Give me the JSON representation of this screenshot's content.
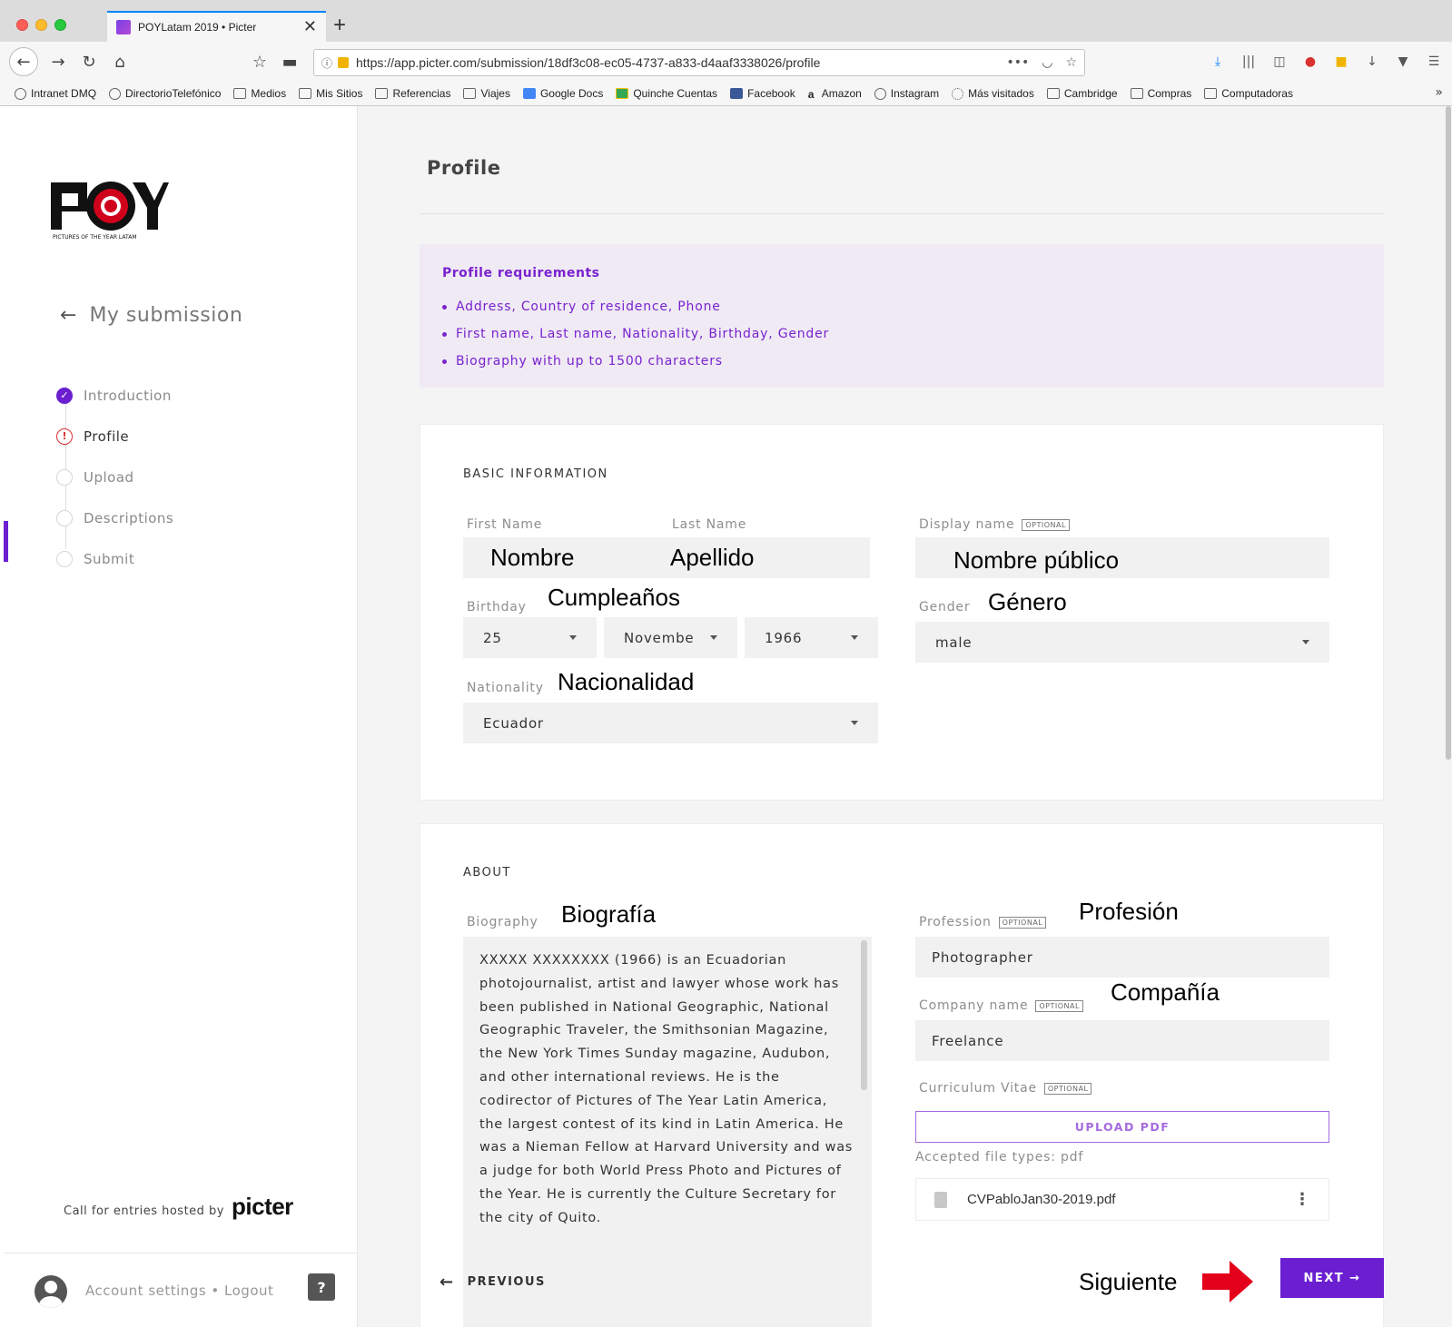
{
  "browser": {
    "tab_title": "POYLatam 2019 • Picter",
    "url": "https://app.picter.com/submission/18df3c08-ec05-4737-a833-d4aaf3338026/profile",
    "bookmarks": [
      "Intranet DMQ",
      "DirectorioTelefónico",
      "Medios",
      "Mis Sitios",
      "Referencias",
      "Viajes",
      "Google Docs",
      "Quinche Cuentas",
      "Facebook",
      "Amazon",
      "Instagram",
      "Más visitados",
      "Cambridge",
      "Compras",
      "Computadoras"
    ]
  },
  "sidebar": {
    "logo_text": "POY",
    "logo_subtitle": "PICTURES OF THE YEAR LATAM",
    "back_label": "My submission",
    "steps": [
      {
        "label": "Introduction",
        "state": "done"
      },
      {
        "label": "Profile",
        "state": "error"
      },
      {
        "label": "Upload",
        "state": "pending"
      },
      {
        "label": "Descriptions",
        "state": "pending"
      },
      {
        "label": "Submit",
        "state": "pending"
      }
    ],
    "hosted_text": "Call for entries hosted by",
    "hosted_brand": "picter",
    "account_links": "Account settings • Logout",
    "help_label": "?"
  },
  "main": {
    "page_title": "Profile",
    "requirements": {
      "title": "Profile requirements",
      "items": [
        "Address, Country of residence, Phone",
        "First name, Last name, Nationality, Birthday, Gender",
        "Biography with up to 1500 characters"
      ]
    },
    "basic": {
      "title": "BASIC INFORMATION",
      "first_name_label": "First Name",
      "first_name_value": "Nombre",
      "last_name_label": "Last Name",
      "last_name_value": "Apellido",
      "display_name_label": "Display name",
      "display_name_value": "Nombre público",
      "optional": "OPTIONAL",
      "birthday_label": "Birthday",
      "birthday_annot": "Cumpleaños",
      "birthday_day": "25",
      "birthday_month": "Novembe",
      "birthday_year": "1966",
      "gender_label": "Gender",
      "gender_annot": "Género",
      "gender_value": "male",
      "nationality_label": "Nationality",
      "nationality_annot": "Nacionalidad",
      "nationality_value": "Ecuador"
    },
    "about": {
      "title": "ABOUT",
      "bio_label": "Biography",
      "bio_annot": "Biografía",
      "bio_text": "XXXXX XXXXXXXX (1966) is an Ecuadorian photojournalist, artist and lawyer whose work has been published in National Geographic, National Geographic Traveler, the Smithsonian Magazine, the New York Times Sunday magazine, Audubon, and other international reviews. He is the codirector of Pictures of The Year Latin America, the largest contest of its kind in Latin America. He was a Nieman Fellow at Harvard University and was a judge for both World Press Photo and Pictures of the Year. He is currently the Culture Secretary for the city of Quito.",
      "profession_label": "Profession",
      "profession_annot": "Profesión",
      "profession_value": "Photographer",
      "company_label": "Company name",
      "company_annot": "Compañía",
      "company_value": "Freelance",
      "cv_label": "Curriculum Vitae",
      "upload_label": "UPLOAD PDF",
      "accepted_types": "Accepted file types: pdf",
      "file_name": "CVPabloJan30-2019.pdf"
    },
    "footer": {
      "previous_label": "PREVIOUS",
      "siguiente_annot": "Siguiente",
      "next_label": "NEXT"
    }
  },
  "colors": {
    "accent": "#6b1fd1",
    "requirements_text": "#7a22d0",
    "error": "#d93030"
  }
}
